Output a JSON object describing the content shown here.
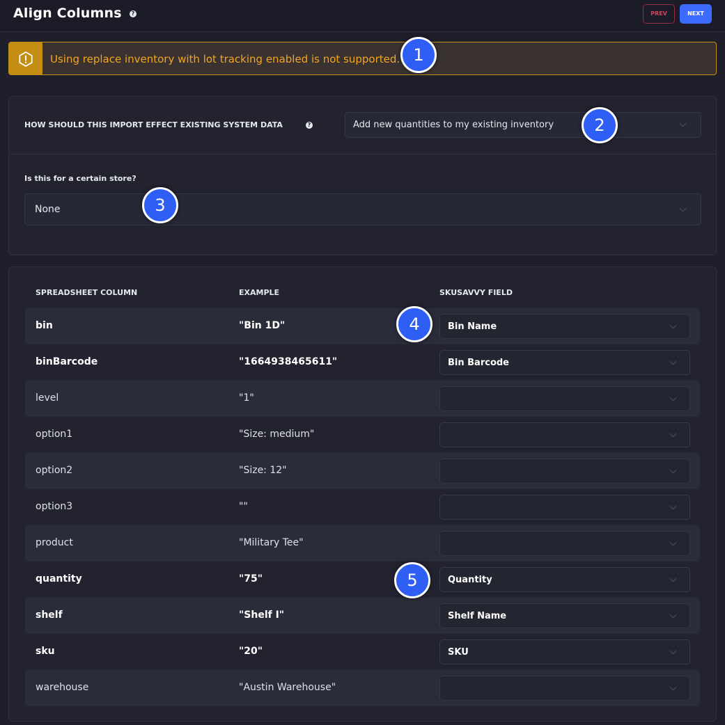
{
  "header": {
    "title": "Align Columns",
    "help_icon": "?",
    "prev_label": "PREV",
    "next_label": "NEXT"
  },
  "warning": {
    "message": "Using replace inventory with lot tracking enabled is not supported.",
    "icon": "warning-icon",
    "color": "#f3a520"
  },
  "settings": {
    "import_label": "HOW SHOULD THIS IMPORT EFFECT EXISTING SYSTEM DATA",
    "import_value": "Add new quantities to my existing inventory",
    "store_label": "Is this for a certain store?",
    "store_value": "None"
  },
  "table": {
    "headers": [
      "SPREADSHEET COLUMN",
      "EXAMPLE",
      "SKUSAVVY FIELD"
    ],
    "rows": [
      {
        "column": "bin",
        "example": "\"Bin 1D\"",
        "field": "Bin Name"
      },
      {
        "column": "binBarcode",
        "example": "\"1664938465611\"",
        "field": "Bin Barcode"
      },
      {
        "column": "level",
        "example": "\"1\"",
        "field": ""
      },
      {
        "column": "option1",
        "example": "\"Size: medium\"",
        "field": ""
      },
      {
        "column": "option2",
        "example": "\"Size: 12\"",
        "field": ""
      },
      {
        "column": "option3",
        "example": "\"\"",
        "field": ""
      },
      {
        "column": "product",
        "example": "\"Military Tee\"",
        "field": ""
      },
      {
        "column": "quantity",
        "example": "\"75\"",
        "field": "Quantity"
      },
      {
        "column": "shelf",
        "example": "\"Shelf I\"",
        "field": "Shelf Name"
      },
      {
        "column": "sku",
        "example": "\"20\"",
        "field": "SKU"
      },
      {
        "column": "warehouse",
        "example": "\"Austin Warehouse\"",
        "field": ""
      }
    ]
  },
  "markers": [
    "1",
    "2",
    "3",
    "4",
    "5"
  ],
  "colors": {
    "accent": "#3d6bff",
    "danger": "#d4455b",
    "warning": "#c48d14",
    "background": "#1e1f2b"
  }
}
